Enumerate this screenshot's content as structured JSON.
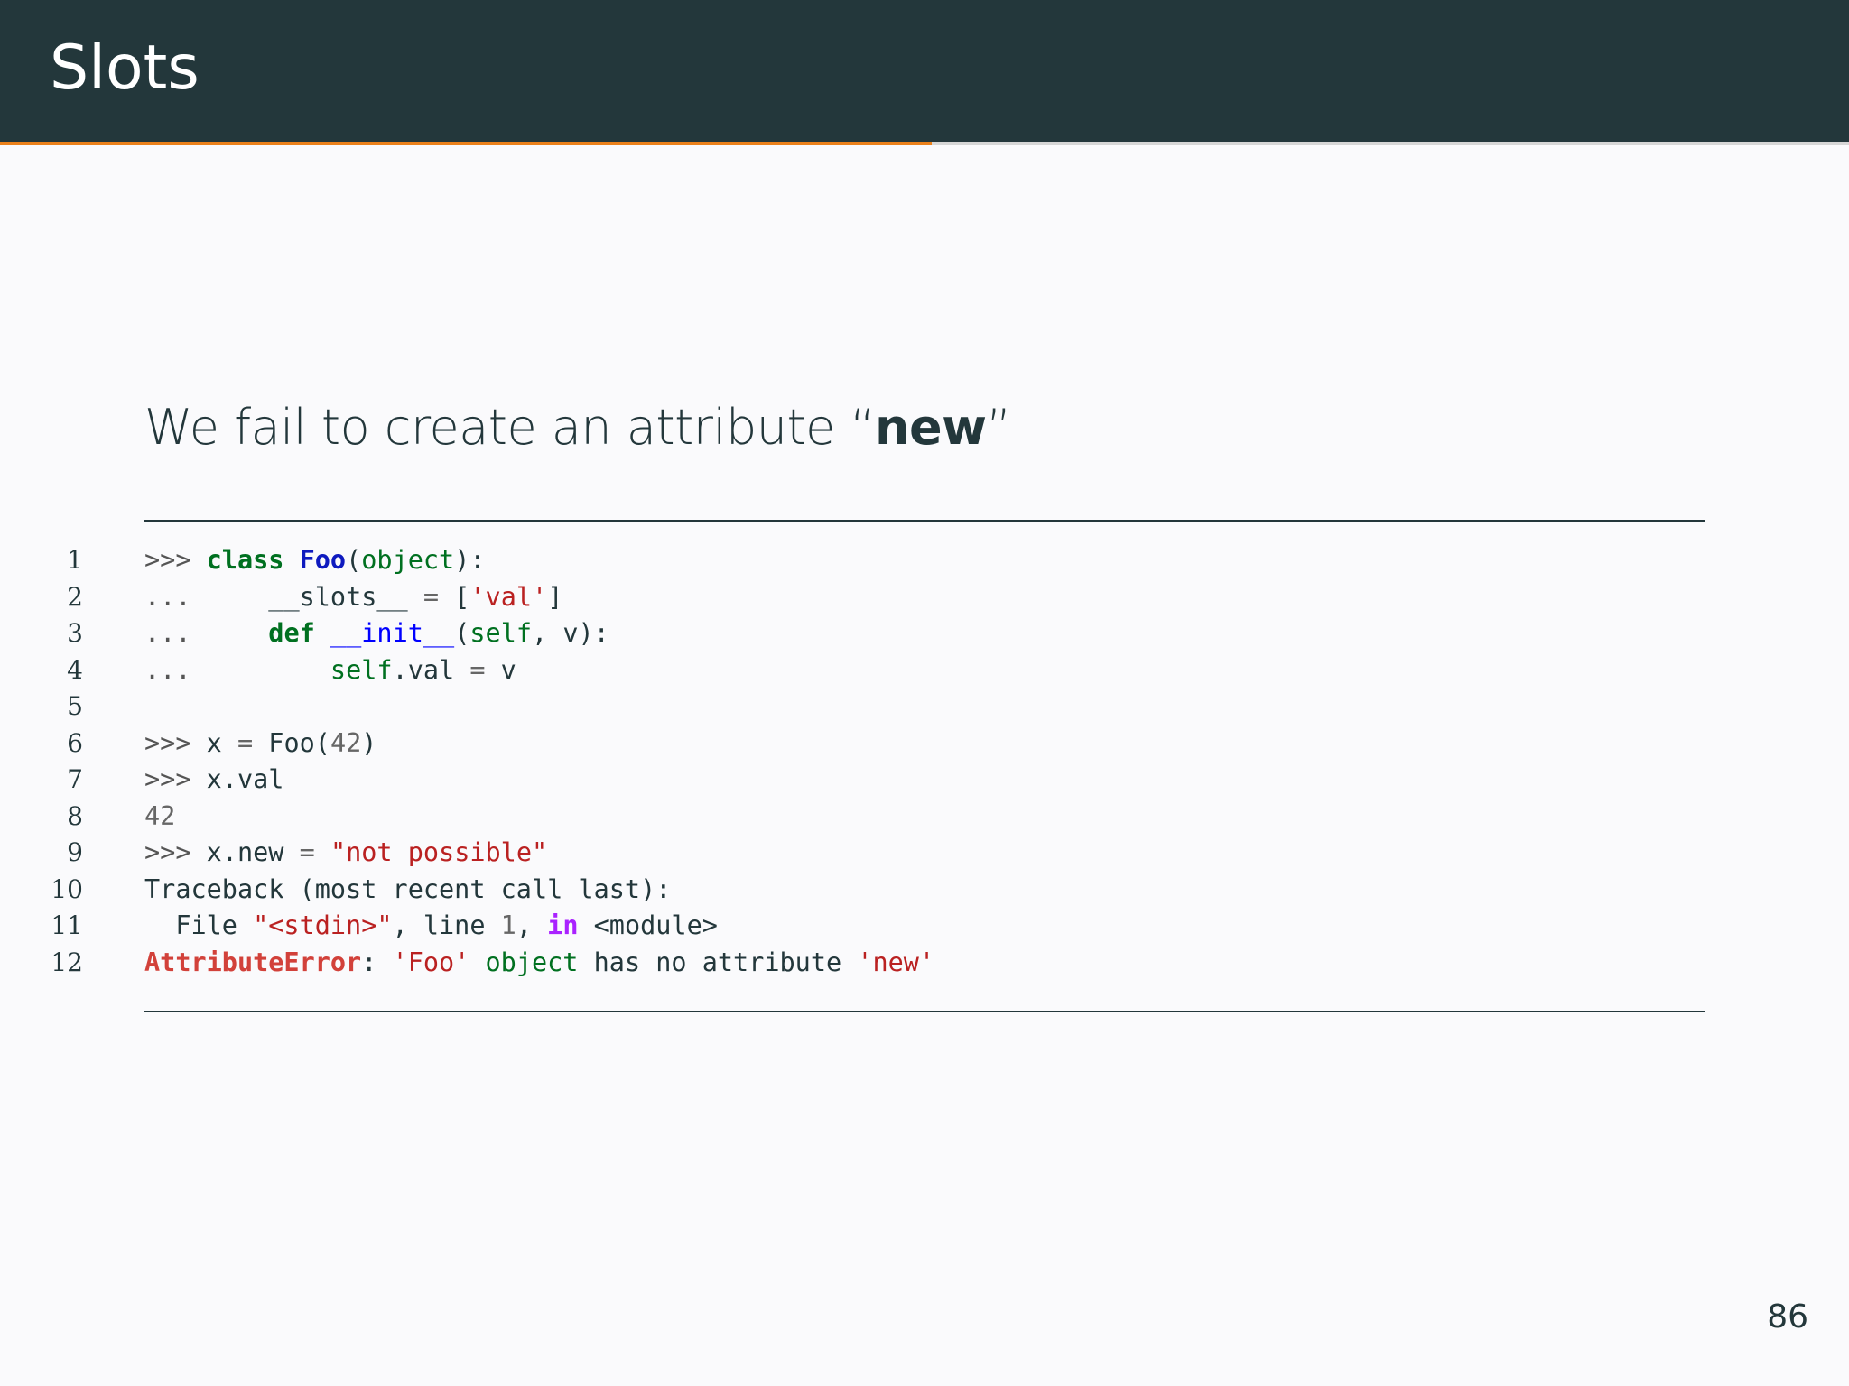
{
  "header": {
    "title": "Slots"
  },
  "progress": {
    "fraction": 0.504,
    "fill_color": "#eb811b",
    "track_color": "#d6d6d6"
  },
  "subtitle": {
    "prefix": "We fail to create an attribute “",
    "highlight": "new",
    "suffix": "”"
  },
  "code": {
    "lines": [
      {
        "n": "1",
        "tokens": [
          {
            "t": ">>> ",
            "c": "prompt"
          },
          {
            "t": "class",
            "c": "kw"
          },
          {
            "t": " ",
            "c": "plain"
          },
          {
            "t": "Foo",
            "c": "cls"
          },
          {
            "t": "(",
            "c": "plain"
          },
          {
            "t": "object",
            "c": "builtin"
          },
          {
            "t": "):",
            "c": "plain"
          }
        ]
      },
      {
        "n": "2",
        "tokens": [
          {
            "t": "...     ",
            "c": "prompt"
          },
          {
            "t": "__slots__",
            "c": "plain"
          },
          {
            "t": " ",
            "c": "plain"
          },
          {
            "t": "=",
            "c": "op"
          },
          {
            "t": " [",
            "c": "plain"
          },
          {
            "t": "'val'",
            "c": "str"
          },
          {
            "t": "]",
            "c": "plain"
          }
        ]
      },
      {
        "n": "3",
        "tokens": [
          {
            "t": "...     ",
            "c": "prompt"
          },
          {
            "t": "def",
            "c": "kw"
          },
          {
            "t": " ",
            "c": "plain"
          },
          {
            "t": "__init__",
            "c": "fn"
          },
          {
            "t": "(",
            "c": "plain"
          },
          {
            "t": "self",
            "c": "builtin"
          },
          {
            "t": ", v):",
            "c": "plain"
          }
        ]
      },
      {
        "n": "4",
        "tokens": [
          {
            "t": "...         ",
            "c": "prompt"
          },
          {
            "t": "self",
            "c": "builtin"
          },
          {
            "t": ".val ",
            "c": "plain"
          },
          {
            "t": "=",
            "c": "op"
          },
          {
            "t": " v",
            "c": "plain"
          }
        ]
      },
      {
        "n": "5",
        "tokens": []
      },
      {
        "n": "6",
        "tokens": [
          {
            "t": ">>> ",
            "c": "prompt"
          },
          {
            "t": "x ",
            "c": "plain"
          },
          {
            "t": "=",
            "c": "op"
          },
          {
            "t": " Foo(",
            "c": "plain"
          },
          {
            "t": "42",
            "c": "num"
          },
          {
            "t": ")",
            "c": "plain"
          }
        ]
      },
      {
        "n": "7",
        "tokens": [
          {
            "t": ">>> ",
            "c": "prompt"
          },
          {
            "t": "x.val",
            "c": "plain"
          }
        ]
      },
      {
        "n": "8",
        "tokens": [
          {
            "t": "42",
            "c": "num"
          }
        ]
      },
      {
        "n": "9",
        "tokens": [
          {
            "t": ">>> ",
            "c": "prompt"
          },
          {
            "t": "x.new ",
            "c": "plain"
          },
          {
            "t": "=",
            "c": "op"
          },
          {
            "t": " ",
            "c": "plain"
          },
          {
            "t": "\"not possible\"",
            "c": "str"
          }
        ]
      },
      {
        "n": "10",
        "tokens": [
          {
            "t": "Traceback (most recent call last):",
            "c": "plain"
          }
        ]
      },
      {
        "n": "11",
        "tokens": [
          {
            "t": "  File ",
            "c": "plain"
          },
          {
            "t": "\"<stdin>\"",
            "c": "str"
          },
          {
            "t": ", line ",
            "c": "plain"
          },
          {
            "t": "1",
            "c": "num"
          },
          {
            "t": ", ",
            "c": "plain"
          },
          {
            "t": "in",
            "c": "inkw"
          },
          {
            "t": " <module>",
            "c": "plain"
          }
        ]
      },
      {
        "n": "12",
        "tokens": [
          {
            "t": "AttributeError",
            "c": "ex"
          },
          {
            "t": ": ",
            "c": "plain"
          },
          {
            "t": "'Foo'",
            "c": "str"
          },
          {
            "t": " ",
            "c": "plain"
          },
          {
            "t": "object",
            "c": "builtin"
          },
          {
            "t": " has no attribute ",
            "c": "plain"
          },
          {
            "t": "'new'",
            "c": "str"
          }
        ]
      }
    ]
  },
  "page_number": "86"
}
